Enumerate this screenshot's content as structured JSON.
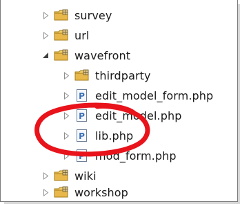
{
  "tree": {
    "items": [
      {
        "label": "survey",
        "icon": "package-folder-icon",
        "expanded": false
      },
      {
        "label": "url",
        "icon": "package-folder-icon",
        "expanded": false
      },
      {
        "label": "wavefront",
        "icon": "package-folder-icon",
        "expanded": true
      },
      {
        "label": "thirdparty",
        "icon": "package-folder-icon",
        "expanded": false
      },
      {
        "label": "edit_model_form.php",
        "icon": "php-file-icon",
        "expanded": false
      },
      {
        "label": "edit_model.php",
        "icon": "php-file-icon",
        "expanded": false
      },
      {
        "label": "lib.php",
        "icon": "php-file-icon",
        "expanded": false
      },
      {
        "label": "mod_form.php",
        "icon": "php-file-icon",
        "expanded": false
      },
      {
        "label": "wiki",
        "icon": "package-folder-icon",
        "expanded": false
      },
      {
        "label": "workshop",
        "icon": "package-folder-icon",
        "expanded": false
      }
    ]
  },
  "php_icon_letter": "P",
  "colors": {
    "highlight_ring": "#e8131b",
    "folder_yellow": "#e9b84a",
    "php_blue": "#3b6fb6"
  }
}
